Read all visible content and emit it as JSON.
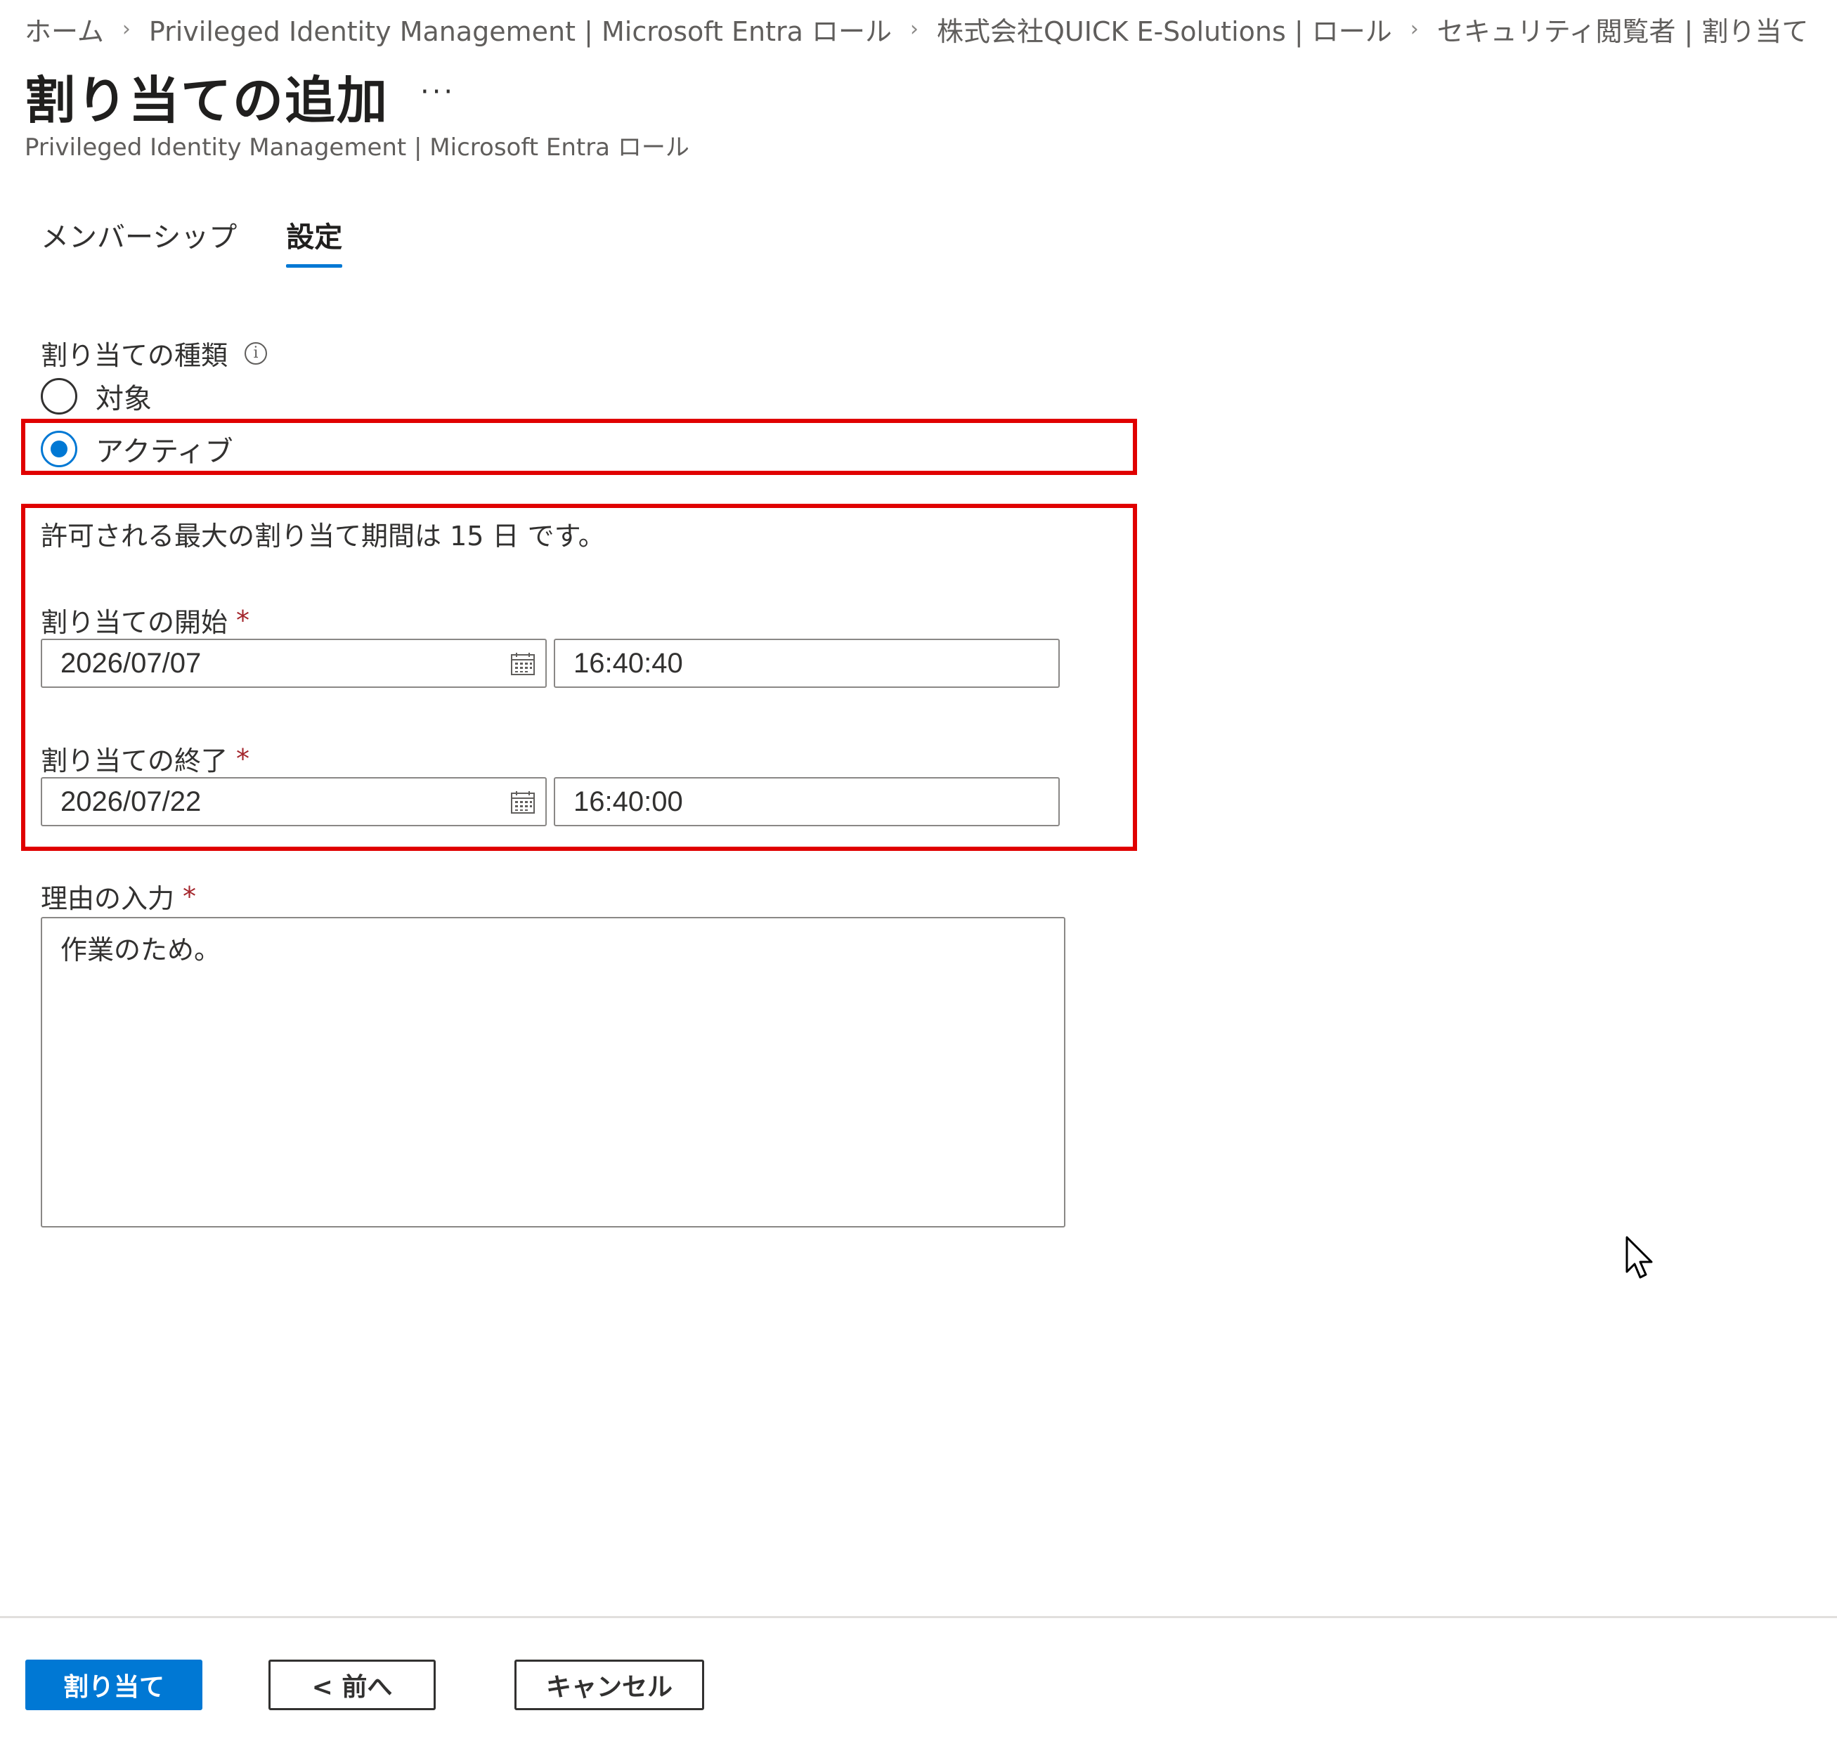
{
  "breadcrumb": [
    "ホーム",
    "Privileged Identity Management | Microsoft Entra ロール",
    "株式会社QUICK E-Solutions | ロール",
    "セキュリティ閲覧者 | 割り当て"
  ],
  "header": {
    "title": "割り当ての追加",
    "more": "···",
    "subtitle": "Privileged Identity Management | Microsoft Entra ロール"
  },
  "tabs": [
    {
      "label": "メンバーシップ",
      "active": false
    },
    {
      "label": "設定",
      "active": true
    }
  ],
  "assignment_type": {
    "label": "割り当ての種類",
    "info_icon": "info-icon",
    "options": [
      {
        "label": "対象",
        "selected": false
      },
      {
        "label": "アクティブ",
        "selected": true
      }
    ]
  },
  "max_duration_text": "許可される最大の割り当て期間は 15 日 です。",
  "start": {
    "label": "割り当ての開始",
    "required_mark": "*",
    "date": "2026/07/07",
    "time": "16:40:40"
  },
  "end": {
    "label": "割り当ての終了",
    "required_mark": "*",
    "date": "2026/07/22",
    "time": "16:40:00"
  },
  "reason": {
    "label": "理由の入力",
    "required_mark": "*",
    "value": "作業のため。"
  },
  "footer": {
    "assign_label": "割り当て",
    "prev_label": "< 前へ",
    "cancel_label": "キャンセル"
  },
  "colors": {
    "accent": "#0078d4",
    "highlight": "#e00000",
    "required": "#a4262c"
  }
}
